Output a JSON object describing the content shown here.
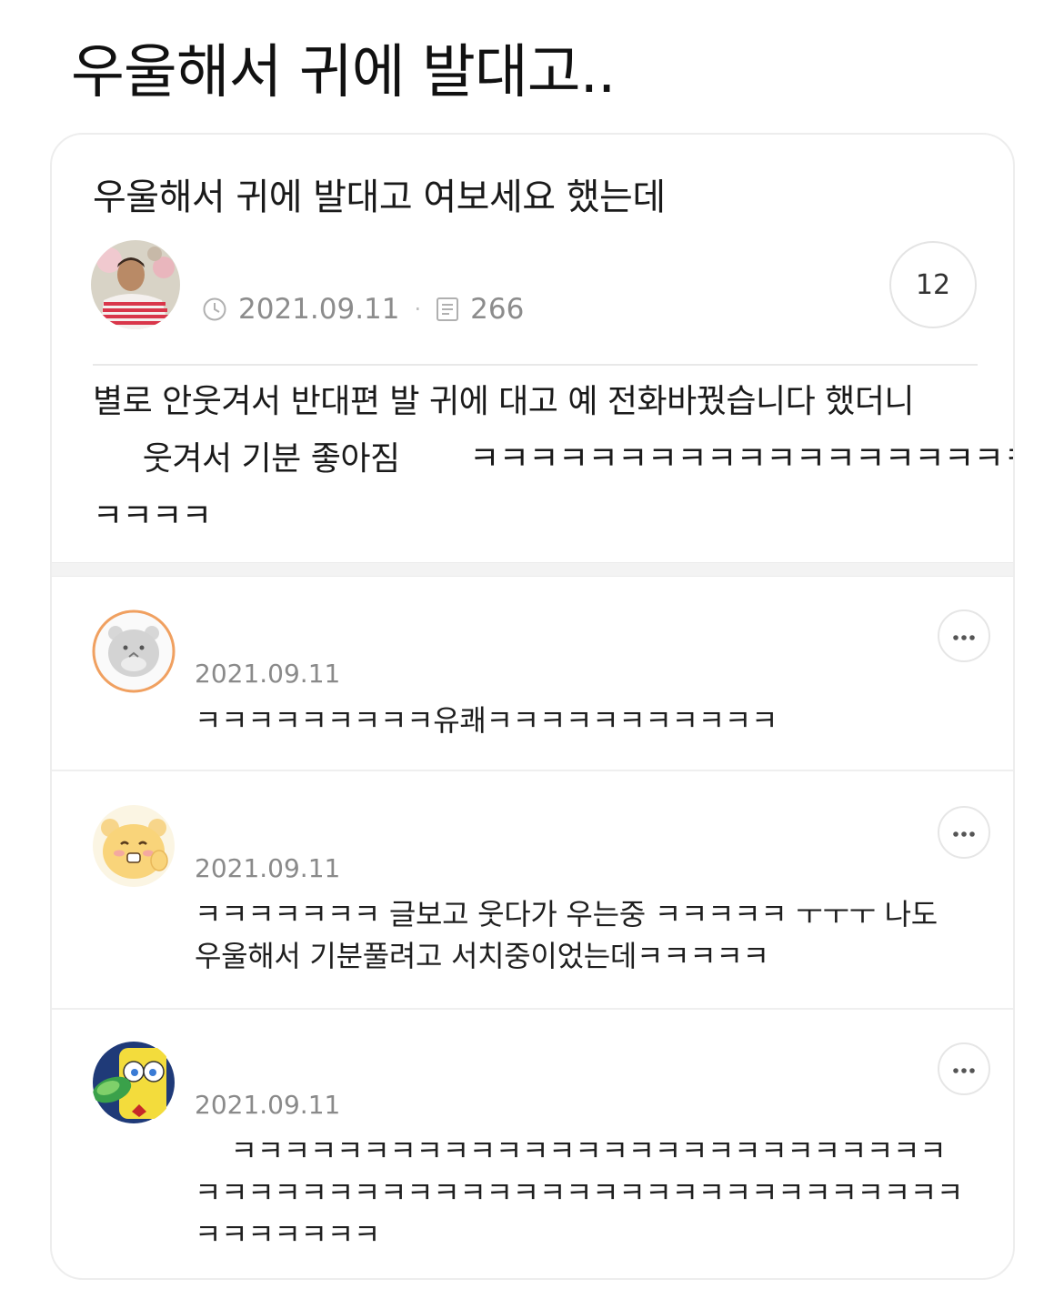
{
  "page": {
    "heading": "우울해서 귀에 발대고.."
  },
  "post": {
    "title": "우울해서 귀에 발대고 여보세요 했는데",
    "date": "2021.09.11",
    "views": "266",
    "comment_count": "12",
    "body_lines": [
      "별로 안웃겨서 반대편 발 귀에 대고 예 전화바꿨습니다 했더니",
      "     웃겨서 기분 좋아짐       ㅋㅋㅋㅋㅋㅋㅋㅋㅋㅋㅋㅋㅋㅋㅋㅋㅋㅋㅋ",
      "ㅋㅋㅋㅋ"
    ]
  },
  "comments": [
    {
      "date": "2021.09.11",
      "lines": [
        "ㅋㅋㅋㅋㅋㅋㅋㅋㅋ유쾌ㅋㅋㅋㅋㅋㅋㅋㅋㅋㅋㅋ"
      ]
    },
    {
      "date": "2021.09.11",
      "lines": [
        "ㅋㅋㅋㅋㅋㅋㅋ 글보고 웃다가 우는중 ㅋㅋㅋㅋㅋ ㅜㅜㅜ 나도",
        "우울해서 기분풀려고 서치중이었는데ㅋㅋㅋㅋㅋ"
      ]
    },
    {
      "date": "2021.09.11",
      "lines": [
        "    ㅋㅋㅋㅋㅋㅋㅋㅋㅋㅋㅋㅋㅋㅋㅋㅋㅋㅋㅋㅋㅋㅋㅋㅋㅋㅋㅋ",
        "ㅋㅋㅋㅋㅋㅋㅋㅋㅋㅋㅋㅋㅋㅋㅋㅋㅋㅋㅋㅋㅋㅋㅋㅋㅋㅋㅋㅋㅋ",
        "ㅋㅋㅋㅋㅋㅋㅋ"
      ]
    }
  ],
  "icons": {
    "date": "clock-icon",
    "views": "document-icon",
    "more": "more-horizontal-icon"
  },
  "colors": {
    "meta_text": "#8c8c8c",
    "border": "#ededed",
    "text": "#1a1a1a"
  }
}
